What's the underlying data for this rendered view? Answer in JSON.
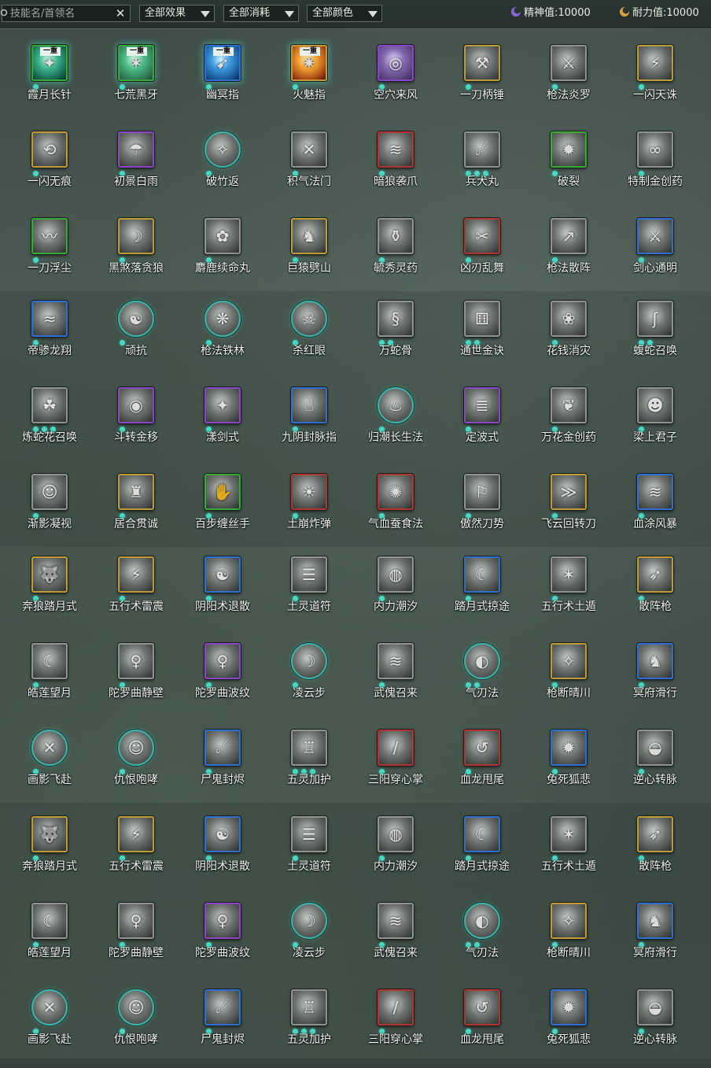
{
  "toolbar": {
    "search_placeholder": "技能名/首领名",
    "clear_glyph": "✕",
    "filters": [
      "全部效果",
      "全部消耗",
      "全部颜色"
    ],
    "spirit_label": "精神值:",
    "spirit_value": "10000",
    "endurance_label": "耐力值:",
    "endurance_value": "10000"
  },
  "colors": {
    "teal_dot": "#48d8c4",
    "spirit_moon": "#8a64d8",
    "endurance_moon": "#d8a040",
    "topbar": "#25302c"
  },
  "skills": [
    {
      "name": "霞月长针",
      "frame": "green",
      "tone": "c-teal",
      "tag": "一重",
      "dots": 1,
      "glyph": "✦",
      "glow": true
    },
    {
      "name": "七荒黑牙",
      "frame": "green",
      "tone": "c-mint",
      "tag": "一重",
      "dots": 1,
      "glyph": "✶",
      "glow": true
    },
    {
      "name": "幽冥指",
      "frame": "blue",
      "tone": "c-blue",
      "tag": "一重",
      "dots": 1,
      "glyph": "➹",
      "glow": true
    },
    {
      "name": "火魅指",
      "frame": "gold",
      "tone": "c-fire",
      "tag": "一重",
      "dots": 1,
      "glyph": "✷",
      "glow": true
    },
    {
      "name": "空穴来风",
      "frame": "purple",
      "tone": "c-purp",
      "tag": "",
      "dots": 1,
      "glyph": "◎"
    },
    {
      "name": "一刀柄锤",
      "frame": "gold",
      "tone": "",
      "tag": "",
      "dots": 1,
      "glyph": "⚒"
    },
    {
      "name": "枪法炎罗",
      "frame": "grey",
      "tone": "",
      "tag": "",
      "dots": 1,
      "glyph": "⚔"
    },
    {
      "name": "一闪天诛",
      "frame": "gold",
      "tone": "",
      "tag": "",
      "dots": 1,
      "glyph": "⚡"
    },
    {
      "name": "一闪无痕",
      "frame": "gold",
      "tone": "",
      "tag": "",
      "dots": 1,
      "glyph": "⟲"
    },
    {
      "name": "初景白雨",
      "frame": "purple",
      "tone": "",
      "tag": "",
      "dots": 1,
      "glyph": "☂"
    },
    {
      "name": "破竹返",
      "frame": "round",
      "tone": "",
      "tag": "",
      "dots": 1,
      "glyph": "✧"
    },
    {
      "name": "积气法门",
      "frame": "grey",
      "tone": "",
      "tag": "",
      "dots": 1,
      "glyph": "✕"
    },
    {
      "name": "暗狼袭爪",
      "frame": "red",
      "tone": "",
      "tag": "",
      "dots": 1,
      "glyph": "≋"
    },
    {
      "name": "兵犬丸",
      "frame": "grey",
      "tone": "",
      "tag": "",
      "dots": 3,
      "glyph": "☄"
    },
    {
      "name": "破裂",
      "frame": "green",
      "tone": "",
      "tag": "",
      "dots": 1,
      "glyph": "✹"
    },
    {
      "name": "特制金创药",
      "frame": "grey",
      "tone": "",
      "tag": "",
      "dots": 1,
      "glyph": "∞"
    },
    {
      "name": "一刀浮尘",
      "frame": "green",
      "tone": "",
      "tag": "",
      "dots": 1,
      "glyph": "〰"
    },
    {
      "name": "黑煞落贪狼",
      "frame": "gold",
      "tone": "",
      "tag": "",
      "dots": 1,
      "glyph": "☽"
    },
    {
      "name": "麝鹿续命丸",
      "frame": "grey",
      "tone": "",
      "tag": "",
      "dots": 1,
      "glyph": "✿"
    },
    {
      "name": "巨猿劈山",
      "frame": "gold",
      "tone": "",
      "tag": "",
      "dots": 1,
      "glyph": "♞"
    },
    {
      "name": "毓秀灵药",
      "frame": "grey",
      "tone": "",
      "tag": "",
      "dots": 1,
      "glyph": "⚱"
    },
    {
      "name": "凶刃乱舞",
      "frame": "red",
      "tone": "",
      "tag": "",
      "dots": 1,
      "glyph": "✂"
    },
    {
      "name": "枪法散阵",
      "frame": "grey",
      "tone": "",
      "tag": "",
      "dots": 1,
      "glyph": "↗"
    },
    {
      "name": "剑心通明",
      "frame": "blue",
      "tone": "",
      "tag": "",
      "dots": 1,
      "glyph": "⚔"
    },
    {
      "name": "帝骖龙翔",
      "frame": "blue",
      "tone": "",
      "tag": "",
      "dots": 1,
      "glyph": "≈"
    },
    {
      "name": "顽抗",
      "frame": "round",
      "tone": "",
      "tag": "",
      "dots": 1,
      "glyph": "☯"
    },
    {
      "name": "枪法铁林",
      "frame": "round",
      "tone": "",
      "tag": "",
      "dots": 1,
      "glyph": "❋"
    },
    {
      "name": "杀红眼",
      "frame": "round",
      "tone": "",
      "tag": "",
      "dots": 1,
      "glyph": "☠"
    },
    {
      "name": "万蛇骨",
      "frame": "grey",
      "tone": "",
      "tag": "",
      "dots": 2,
      "glyph": "§"
    },
    {
      "name": "通世金诀",
      "frame": "grey",
      "tone": "",
      "tag": "",
      "dots": 2,
      "glyph": "⚅"
    },
    {
      "name": "花钱消灾",
      "frame": "grey",
      "tone": "",
      "tag": "",
      "dots": 1,
      "glyph": "❀"
    },
    {
      "name": "蝮蛇召唤",
      "frame": "grey",
      "tone": "",
      "tag": "",
      "dots": 2,
      "glyph": "ʃ"
    },
    {
      "name": "炼蛇花召唤",
      "frame": "grey",
      "tone": "",
      "tag": "",
      "dots": 3,
      "glyph": "☘"
    },
    {
      "name": "斗转金移",
      "frame": "purple",
      "tone": "",
      "tag": "",
      "dots": 1,
      "glyph": "◉"
    },
    {
      "name": "漾剑式",
      "frame": "purple",
      "tone": "",
      "tag": "",
      "dots": 1,
      "glyph": "✦"
    },
    {
      "name": "九阴封脉指",
      "frame": "blue",
      "tone": "",
      "tag": "",
      "dots": 1,
      "glyph": "☝"
    },
    {
      "name": "归潮长生法",
      "frame": "round",
      "tone": "",
      "tag": "",
      "dots": 1,
      "glyph": "♨"
    },
    {
      "name": "定波式",
      "frame": "purple",
      "tone": "",
      "tag": "",
      "dots": 1,
      "glyph": "≣"
    },
    {
      "name": "万花金创药",
      "frame": "grey",
      "tone": "",
      "tag": "",
      "dots": 1,
      "glyph": "❦"
    },
    {
      "name": "梁上君子",
      "frame": "grey",
      "tone": "",
      "tag": "",
      "dots": 1,
      "glyph": "☻"
    },
    {
      "name": "渐影凝视",
      "frame": "grey",
      "tone": "",
      "tag": "",
      "dots": 1,
      "glyph": "☺"
    },
    {
      "name": "居合贯诚",
      "frame": "gold",
      "tone": "",
      "tag": "",
      "dots": 1,
      "glyph": "♜"
    },
    {
      "name": "百步缠丝手",
      "frame": "green",
      "tone": "",
      "tag": "",
      "dots": 1,
      "glyph": "✋"
    },
    {
      "name": "土崩炸弹",
      "frame": "red",
      "tone": "",
      "tag": "",
      "dots": 1,
      "glyph": "☀"
    },
    {
      "name": "气血蚕食法",
      "frame": "red",
      "tone": "",
      "tag": "",
      "dots": 1,
      "glyph": "✺"
    },
    {
      "name": "傲然刀势",
      "frame": "grey",
      "tone": "",
      "tag": "",
      "dots": 1,
      "glyph": "⚐"
    },
    {
      "name": "飞云回转刀",
      "frame": "gold",
      "tone": "",
      "tag": "",
      "dots": 1,
      "glyph": "≫"
    },
    {
      "name": "血涂风暴",
      "frame": "blue",
      "tone": "",
      "tag": "",
      "dots": 1,
      "glyph": "≋"
    },
    {
      "name": "奔狼踏月式",
      "frame": "gold",
      "tone": "",
      "tag": "",
      "dots": 1,
      "glyph": "🐺"
    },
    {
      "name": "五行术雷震",
      "frame": "gold",
      "tone": "",
      "tag": "",
      "dots": 1,
      "glyph": "⚡"
    },
    {
      "name": "阴阳术退散",
      "frame": "blue",
      "tone": "",
      "tag": "",
      "dots": 1,
      "glyph": "☯"
    },
    {
      "name": "土灵道符",
      "frame": "grey",
      "tone": "",
      "tag": "",
      "dots": 1,
      "glyph": "☰"
    },
    {
      "name": "内力潮汐",
      "frame": "grey",
      "tone": "",
      "tag": "",
      "dots": 1,
      "glyph": "◍"
    },
    {
      "name": "踏月式掠途",
      "frame": "blue",
      "tone": "",
      "tag": "",
      "dots": 1,
      "glyph": "☾"
    },
    {
      "name": "五行术土遁",
      "frame": "grey",
      "tone": "",
      "tag": "",
      "dots": 1,
      "glyph": "✶"
    },
    {
      "name": "散阵枪",
      "frame": "gold",
      "tone": "",
      "tag": "",
      "dots": 1,
      "glyph": "➶"
    },
    {
      "name": "皓莲望月",
      "frame": "grey",
      "tone": "",
      "tag": "",
      "dots": 1,
      "glyph": "☾"
    },
    {
      "name": "陀罗曲静壁",
      "frame": "grey",
      "tone": "",
      "tag": "",
      "dots": 1,
      "glyph": "♀"
    },
    {
      "name": "陀罗曲波纹",
      "frame": "purple",
      "tone": "",
      "tag": "",
      "dots": 1,
      "glyph": "♀"
    },
    {
      "name": "凌云步",
      "frame": "round",
      "tone": "",
      "tag": "",
      "dots": 1,
      "glyph": "☽"
    },
    {
      "name": "武傀召来",
      "frame": "grey",
      "tone": "",
      "tag": "",
      "dots": 1,
      "glyph": "≋"
    },
    {
      "name": "气刃法",
      "frame": "round",
      "tone": "",
      "tag": "",
      "dots": 2,
      "glyph": "◐"
    },
    {
      "name": "枪断晴川",
      "frame": "gold",
      "tone": "",
      "tag": "",
      "dots": 1,
      "glyph": "✧"
    },
    {
      "name": "冥府滑行",
      "frame": "blue",
      "tone": "",
      "tag": "",
      "dots": 1,
      "glyph": "♞"
    },
    {
      "name": "画影飞赴",
      "frame": "round",
      "tone": "",
      "tag": "",
      "dots": 1,
      "glyph": "✕"
    },
    {
      "name": "仇恨咆哮",
      "frame": "round",
      "tone": "",
      "tag": "",
      "dots": 1,
      "glyph": "☺"
    },
    {
      "name": "尸鬼封烬",
      "frame": "blue",
      "tone": "",
      "tag": "",
      "dots": 1,
      "glyph": "☄"
    },
    {
      "name": "五灵加护",
      "frame": "grey",
      "tone": "",
      "tag": "",
      "dots": 3,
      "glyph": "♖"
    },
    {
      "name": "三阳穿心掌",
      "frame": "red",
      "tone": "",
      "tag": "",
      "dots": 1,
      "glyph": "/"
    },
    {
      "name": "血龙甩尾",
      "frame": "red",
      "tone": "",
      "tag": "",
      "dots": 1,
      "glyph": "↺"
    },
    {
      "name": "兔死狐悲",
      "frame": "blue",
      "tone": "",
      "tag": "",
      "dots": 1,
      "glyph": "✹"
    },
    {
      "name": "逆心转脉",
      "frame": "grey",
      "tone": "",
      "tag": "",
      "dots": 1,
      "glyph": "◒"
    },
    {
      "name": "奔狼踏月式",
      "frame": "gold",
      "tone": "",
      "tag": "",
      "dots": 1,
      "glyph": "🐺"
    },
    {
      "name": "五行术雷震",
      "frame": "gold",
      "tone": "",
      "tag": "",
      "dots": 1,
      "glyph": "⚡"
    },
    {
      "name": "阴阳术退散",
      "frame": "blue",
      "tone": "",
      "tag": "",
      "dots": 1,
      "glyph": "☯"
    },
    {
      "name": "土灵道符",
      "frame": "grey",
      "tone": "",
      "tag": "",
      "dots": 1,
      "glyph": "☰"
    },
    {
      "name": "内力潮汐",
      "frame": "grey",
      "tone": "",
      "tag": "",
      "dots": 1,
      "glyph": "◍"
    },
    {
      "name": "踏月式掠途",
      "frame": "blue",
      "tone": "",
      "tag": "",
      "dots": 1,
      "glyph": "☾"
    },
    {
      "name": "五行术土遁",
      "frame": "grey",
      "tone": "",
      "tag": "",
      "dots": 1,
      "glyph": "✶"
    },
    {
      "name": "散阵枪",
      "frame": "gold",
      "tone": "",
      "tag": "",
      "dots": 1,
      "glyph": "➶"
    },
    {
      "name": "皓莲望月",
      "frame": "grey",
      "tone": "",
      "tag": "",
      "dots": 1,
      "glyph": "☾"
    },
    {
      "name": "陀罗曲静壁",
      "frame": "grey",
      "tone": "",
      "tag": "",
      "dots": 1,
      "glyph": "♀"
    },
    {
      "name": "陀罗曲波纹",
      "frame": "purple",
      "tone": "",
      "tag": "",
      "dots": 1,
      "glyph": "♀"
    },
    {
      "name": "凌云步",
      "frame": "round",
      "tone": "",
      "tag": "",
      "dots": 1,
      "glyph": "☽"
    },
    {
      "name": "武傀召来",
      "frame": "grey",
      "tone": "",
      "tag": "",
      "dots": 1,
      "glyph": "≋"
    },
    {
      "name": "气刃法",
      "frame": "round",
      "tone": "",
      "tag": "",
      "dots": 2,
      "glyph": "◐"
    },
    {
      "name": "枪断晴川",
      "frame": "gold",
      "tone": "",
      "tag": "",
      "dots": 1,
      "glyph": "✧"
    },
    {
      "name": "冥府滑行",
      "frame": "blue",
      "tone": "",
      "tag": "",
      "dots": 1,
      "glyph": "♞"
    },
    {
      "name": "画影飞赴",
      "frame": "round",
      "tone": "",
      "tag": "",
      "dots": 1,
      "glyph": "✕"
    },
    {
      "name": "仇恨咆哮",
      "frame": "round",
      "tone": "",
      "tag": "",
      "dots": 1,
      "glyph": "☺"
    },
    {
      "name": "尸鬼封烬",
      "frame": "blue",
      "tone": "",
      "tag": "",
      "dots": 1,
      "glyph": "☄"
    },
    {
      "name": "五灵加护",
      "frame": "grey",
      "tone": "",
      "tag": "",
      "dots": 3,
      "glyph": "♖"
    },
    {
      "name": "三阳穿心掌",
      "frame": "red",
      "tone": "",
      "tag": "",
      "dots": 1,
      "glyph": "/"
    },
    {
      "name": "血龙甩尾",
      "frame": "red",
      "tone": "",
      "tag": "",
      "dots": 1,
      "glyph": "↺"
    },
    {
      "name": "兔死狐悲",
      "frame": "blue",
      "tone": "",
      "tag": "",
      "dots": 1,
      "glyph": "✹"
    },
    {
      "name": "逆心转脉",
      "frame": "grey",
      "tone": "",
      "tag": "",
      "dots": 1,
      "glyph": "◒"
    }
  ]
}
